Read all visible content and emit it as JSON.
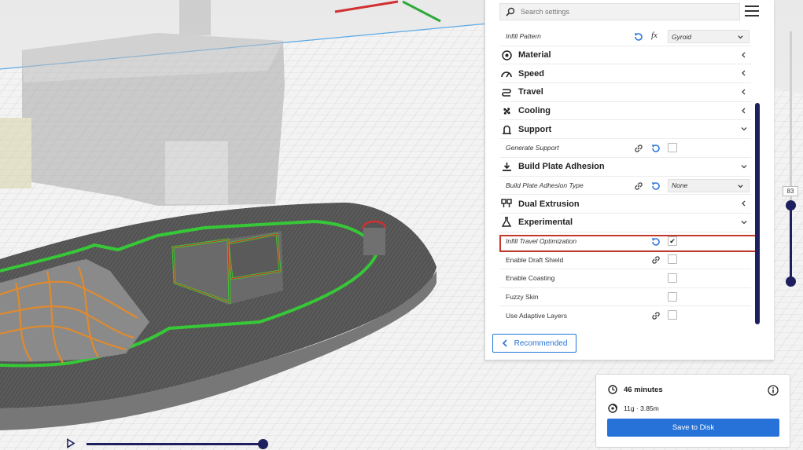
{
  "search": {
    "placeholder": "Search settings"
  },
  "settings": {
    "infill_pattern": {
      "label": "Infill Pattern",
      "value": "Gyroid"
    },
    "categories": {
      "material": "Material",
      "speed": "Speed",
      "travel": "Travel",
      "cooling": "Cooling",
      "support": "Support",
      "adhesion": "Build Plate Adhesion",
      "dual": "Dual Extrusion",
      "experimental": "Experimental"
    },
    "generate_support": {
      "label": "Generate Support",
      "checked": false
    },
    "adhesion_type": {
      "label": "Build Plate Adhesion Type",
      "value": "None"
    },
    "infill_travel_opt": {
      "label": "Infill Travel Optimization",
      "checked": true
    },
    "draft_shield": {
      "label": "Enable Draft Shield",
      "checked": false
    },
    "coasting": {
      "label": "Enable Coasting",
      "checked": false
    },
    "fuzzy_skin": {
      "label": "Fuzzy Skin",
      "checked": false
    },
    "adaptive_layers": {
      "label": "Use Adaptive Layers",
      "checked": false
    },
    "fx_symbol": "fx",
    "checkmark": "✔"
  },
  "recommended_button": "Recommended",
  "layer_slider": {
    "current_layer": "83"
  },
  "print_info": {
    "time": "46 minutes",
    "material": "11g · 3.85m",
    "save_label": "Save to Disk"
  },
  "colors": {
    "accent": "#2672d8",
    "navy": "#1e1f5e",
    "highlight": "#c0392b",
    "outer_wall": "#37c837",
    "infill": "#e08a2e"
  },
  "icons": {
    "search": "search-icon",
    "menu": "hamburger-menu-icon",
    "reset": "reset-icon",
    "link": "link-icon",
    "chevron_left": "chevron-left-icon",
    "chevron_down": "chevron-down-icon",
    "clock": "clock-icon",
    "spool": "spool-icon",
    "info": "info-icon",
    "play": "play-icon"
  }
}
